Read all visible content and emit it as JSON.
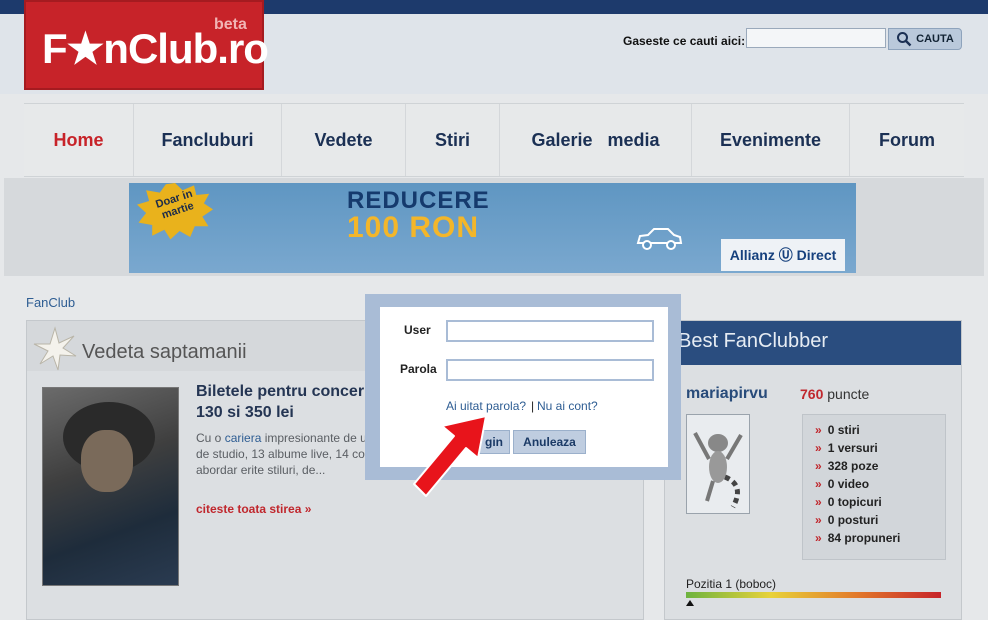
{
  "logo": {
    "text": "F★nClub.ro",
    "beta": "beta"
  },
  "search": {
    "label": "Gaseste ce cauti aici:",
    "value": "",
    "button_label": "CAUTA"
  },
  "nav": {
    "items": [
      "Home",
      "Fancluburi",
      "Vedete",
      "Stiri",
      "Galerie   media",
      "Evenimente",
      "Forum"
    ],
    "active": "Home"
  },
  "banner": {
    "badge": "Doar in martie",
    "line1": "REDUCERE",
    "line2": "100 RON",
    "brand": "Allianz Ⓤ Direct"
  },
  "breadcrumb": "FanClub",
  "weekly_star": {
    "title": "Vedeta saptamanii",
    "headline": "Biletele pentru concer 130 si 350 lei",
    "body_prefix": "Cu o ",
    "body_link": "cariera",
    "body_rest": " impresionante de unul dintre putinii artisti al carora de studio, 13 albume live, 14 co care a fost inzestrat i-a permis abordar        erite stiluri, de...",
    "read_more": "citeste toata stirea »"
  },
  "best_fanclubber": {
    "title": "Best FanClubber",
    "username": "mariapirvu",
    "points_value": "760",
    "points_label": " puncte",
    "stats": [
      "0 stiri",
      "1 versuri",
      "328 poze",
      "0 video",
      "0 topicuri",
      "0 posturi",
      "84 propuneri"
    ],
    "rank": "Pozitia 1 (boboc)"
  },
  "login_modal": {
    "user_label": "User",
    "user_value": "",
    "password_label": "Parola",
    "password_value": "",
    "forgot_link": "Ai uitat parola?",
    "separator": "|",
    "register_link": "Nu ai cont?",
    "login_button": "gin",
    "cancel_button": "Anuleaza"
  },
  "colors": {
    "brand_red": "#c72329",
    "navy": "#1d3a6c",
    "modal_border": "#a9bcd6",
    "annotation_red": "#e8141b"
  }
}
